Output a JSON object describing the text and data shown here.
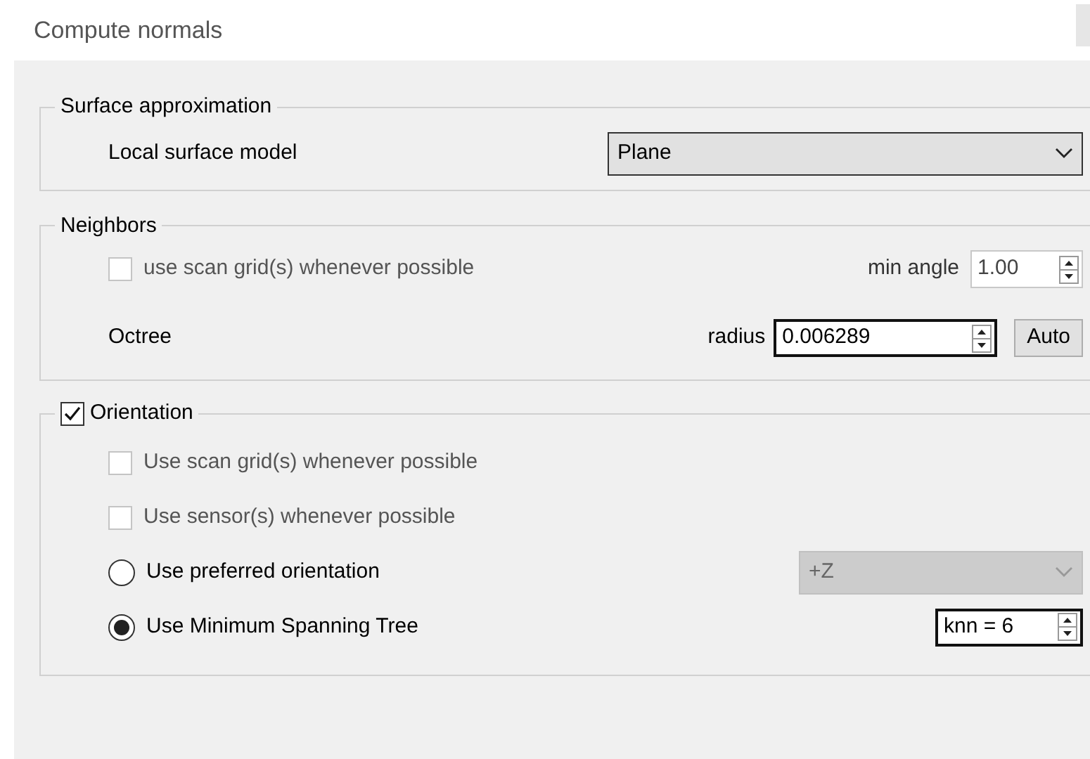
{
  "window": {
    "title": "Compute normals"
  },
  "surface_approximation": {
    "title": "Surface approximation",
    "local_surface_model": {
      "label": "Local surface model",
      "value": "Plane",
      "disabled": false
    }
  },
  "neighbors": {
    "title": "Neighbors",
    "scan_grid": {
      "label": "use scan grid(s) whenever possible",
      "checked": false,
      "disabled": true
    },
    "min_angle": {
      "label": "min angle",
      "value": "1.00",
      "disabled": true
    },
    "octree_label": "Octree",
    "radius": {
      "label": "radius",
      "value": "0.006289",
      "disabled": false
    },
    "auto_button": "Auto"
  },
  "orientation": {
    "title": "Orientation",
    "checked": true,
    "options": [
      {
        "kind": "checkbox",
        "label": "Use scan grid(s) whenever possible",
        "checked": false,
        "disabled": true
      },
      {
        "kind": "checkbox",
        "label": "Use sensor(s) whenever possible",
        "checked": false,
        "disabled": true
      },
      {
        "kind": "radio",
        "label": "Use preferred orientation",
        "selected": false,
        "control": {
          "kind": "combo",
          "value": "+Z",
          "disabled": true
        }
      },
      {
        "kind": "radio",
        "label": "Use Minimum Spanning Tree",
        "selected": true,
        "control": {
          "kind": "spin",
          "value": "knn = 6",
          "disabled": false
        }
      }
    ]
  }
}
